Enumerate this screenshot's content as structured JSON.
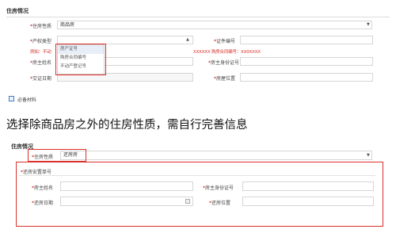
{
  "top_form": {
    "section_title": "住房情况",
    "housing_nature": {
      "label": "住房性质",
      "value": "商品房"
    },
    "property_type": {
      "label": "产权类型",
      "value": ""
    },
    "property_type_options": [
      "房产证号",
      "购房合同编号",
      "不动产登记号"
    ],
    "certificate_no": {
      "label": "证件编号",
      "value": ""
    },
    "overlay_left": "例如：不动",
    "overlay_right": "XXXXXX 购房合同编号：XX0XXXX",
    "owner_name": {
      "label": "房主姓名"
    },
    "owner_id": {
      "label": "房主身份证号"
    },
    "relocation_date": {
      "label": "交证日期"
    },
    "house_location": {
      "label": "房屋位置"
    },
    "required_docs": "必备材料"
  },
  "caption": "选择除商品房之外的住房性质，需自行完善信息",
  "bottom_form": {
    "section_title": "住房情况",
    "housing_nature": {
      "label": "住房性质",
      "value": "还房房"
    },
    "relocation_order_no": {
      "label": "还房安置单号"
    },
    "owner_name": {
      "label": "房主姓名"
    },
    "owner_id": {
      "label": "房主身份证号"
    },
    "relocation_date": {
      "label": "还房日期"
    },
    "relocation_location": {
      "label": "还房位置"
    }
  }
}
